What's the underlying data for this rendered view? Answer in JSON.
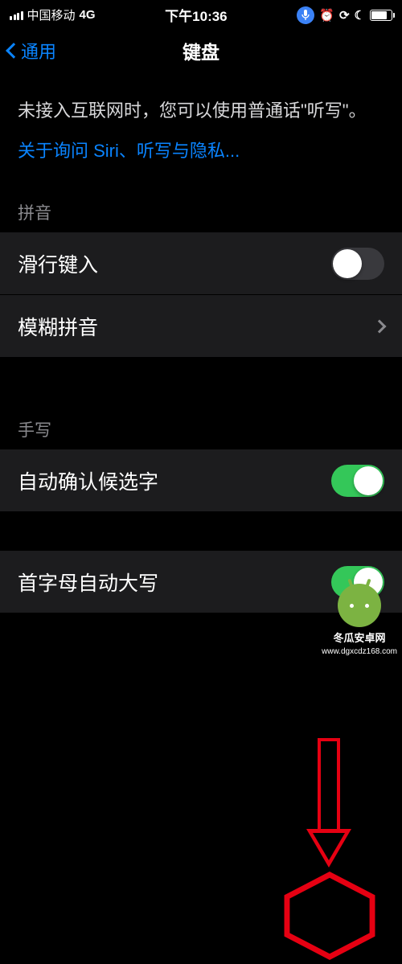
{
  "status": {
    "carrier": "中国移动",
    "network": "4G",
    "time": "下午10:36"
  },
  "nav": {
    "back": "通用",
    "title": "键盘"
  },
  "info": {
    "text": "未接入互联网时，您可以使用普通话\"听写\"。",
    "link": "关于询问 Siri、听写与隐私..."
  },
  "sections": {
    "pinyin": {
      "header": "拼音",
      "swipe_label": "滑行键入",
      "swipe_on": false,
      "fuzzy_label": "模糊拼音"
    },
    "handwriting": {
      "header": "手写",
      "auto_confirm_label": "自动确认候选字",
      "auto_confirm_on": true
    },
    "general": {
      "auto_caps_label": "首字母自动大写",
      "auto_caps_on": true
    }
  },
  "watermark": {
    "name": "冬瓜安卓网",
    "url": "www.dgxcdz168.com"
  }
}
